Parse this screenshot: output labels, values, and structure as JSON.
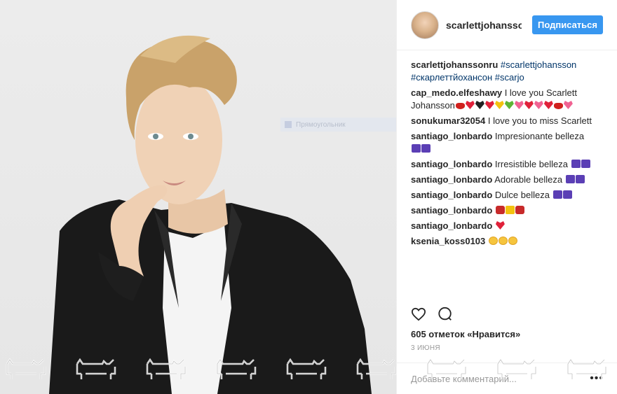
{
  "post": {
    "username": "scarlettjohanssonr",
    "follow_label": "Подписаться"
  },
  "comments": [
    {
      "user": "scarlettjohanssonru",
      "text": "#scarlettjohansson #скарлеттйохансон #scarjo"
    },
    {
      "user": "cap_medo.elfeshawy",
      "text": "I love you Scarlett Johansson"
    },
    {
      "user": "sonukumar32054",
      "text": "I love you to miss Scarlett"
    },
    {
      "user": "santiago_lonbardo",
      "text": "Impresionante belleza"
    },
    {
      "user": "santiago_lonbardo",
      "text": "Irresistible belleza"
    },
    {
      "user": "santiago_lonbardo",
      "text": "Adorable belleza"
    },
    {
      "user": "santiago_lonbardo",
      "text": "Dulce belleza"
    },
    {
      "user": "santiago_lonbardo",
      "text": ""
    },
    {
      "user": "santiago_lonbardo",
      "text": ""
    },
    {
      "user": "ksenia_koss0103",
      "text": ""
    }
  ],
  "likes_text": "605 отметок «Нравится»",
  "date_text": "3 ИЮНЯ",
  "add_comment_placeholder": "Добавьте комментарий...",
  "more_label": "•••",
  "tooltip_text": "Прямоугольник",
  "icons": [
    "heart-icon",
    "comment-icon",
    "more-icon"
  ],
  "colors": {
    "follow": "#3897f0",
    "link": "#003569",
    "text": "#262626",
    "muted": "#999999"
  }
}
